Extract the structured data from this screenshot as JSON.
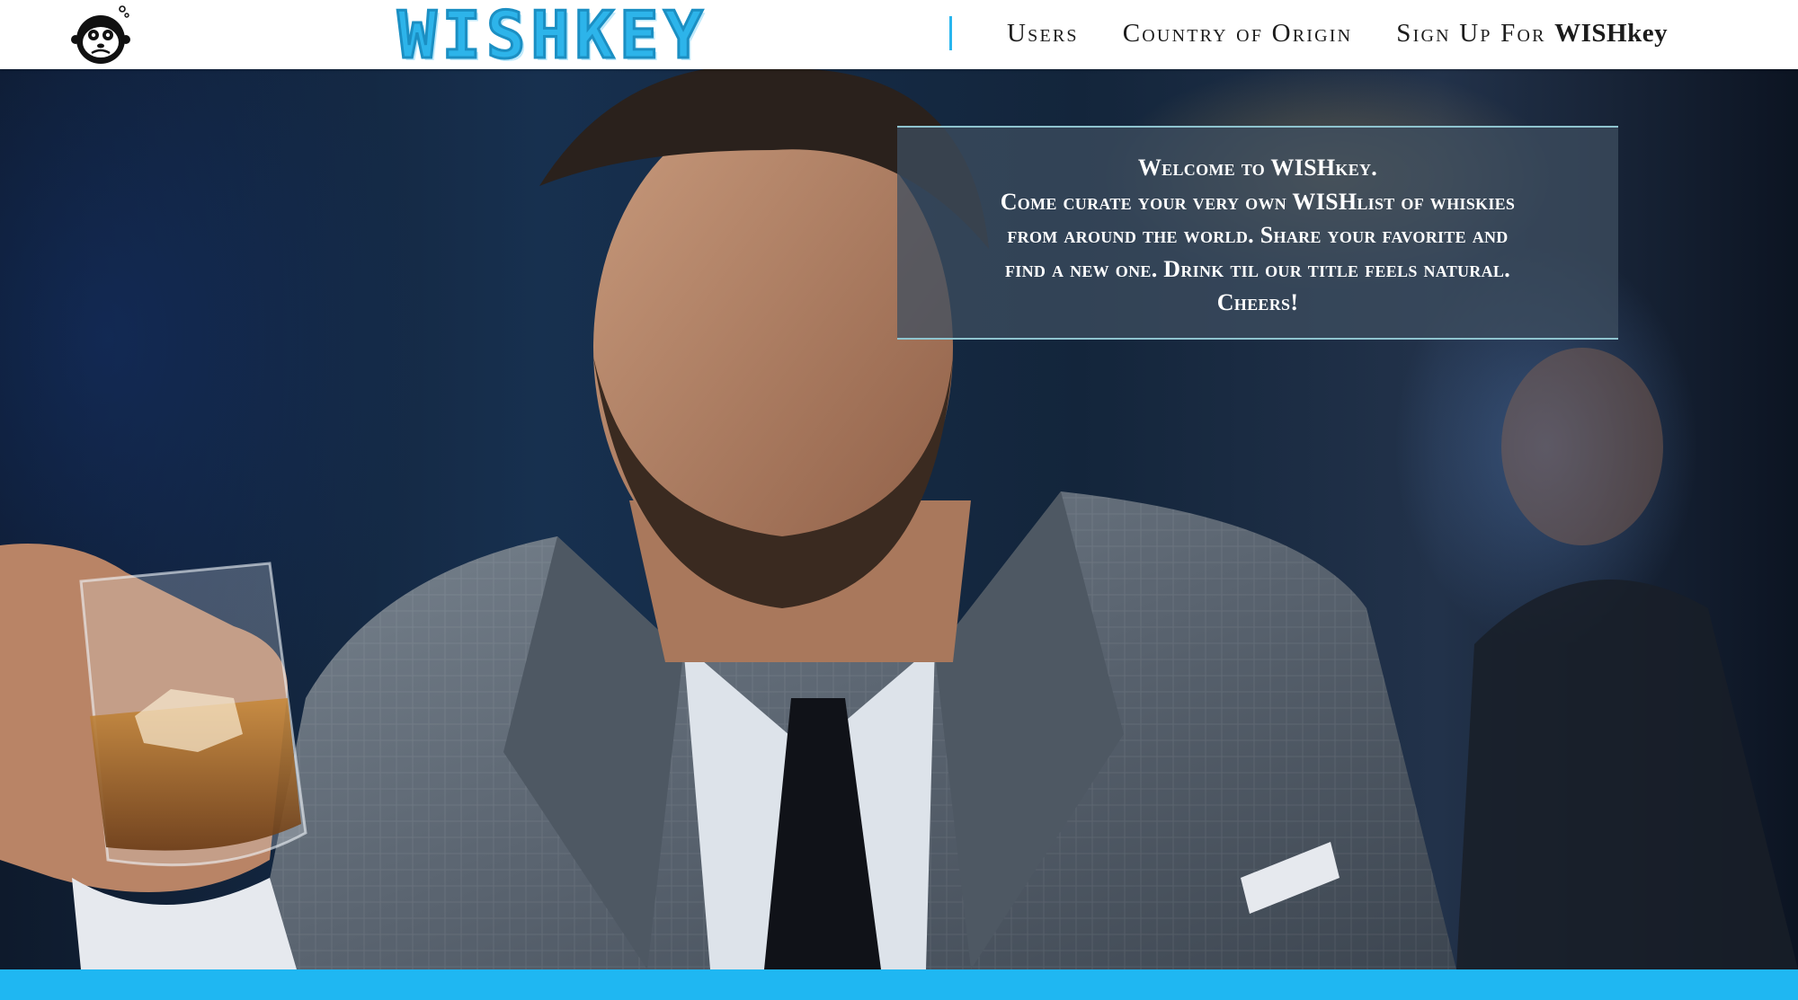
{
  "header": {
    "logo_icon": "monkey-face-icon",
    "wordmark": "WISHKEY",
    "nav": {
      "users": "Users",
      "country_of_origin": "Country of Origin",
      "sign_up_prefix": "Sign Up For",
      "sign_up_brand": "WISHkey"
    }
  },
  "hero": {
    "image": "man-in-suit-holding-whiskey-glass",
    "welcome_lines": [
      "Welcome to WISHkey.",
      "Come curate your very own WISHlist of whiskies",
      "from around the world. Share your favorite and",
      "find a new one. Drink til our title feels natural.",
      "Cheers!"
    ]
  },
  "colors": {
    "accent": "#1fb7f2",
    "nav_text": "#1c1c1c",
    "header_bg": "#ffffff",
    "welcome_box_bg": "#3e4e60",
    "welcome_box_border": "#8fc4cf"
  }
}
